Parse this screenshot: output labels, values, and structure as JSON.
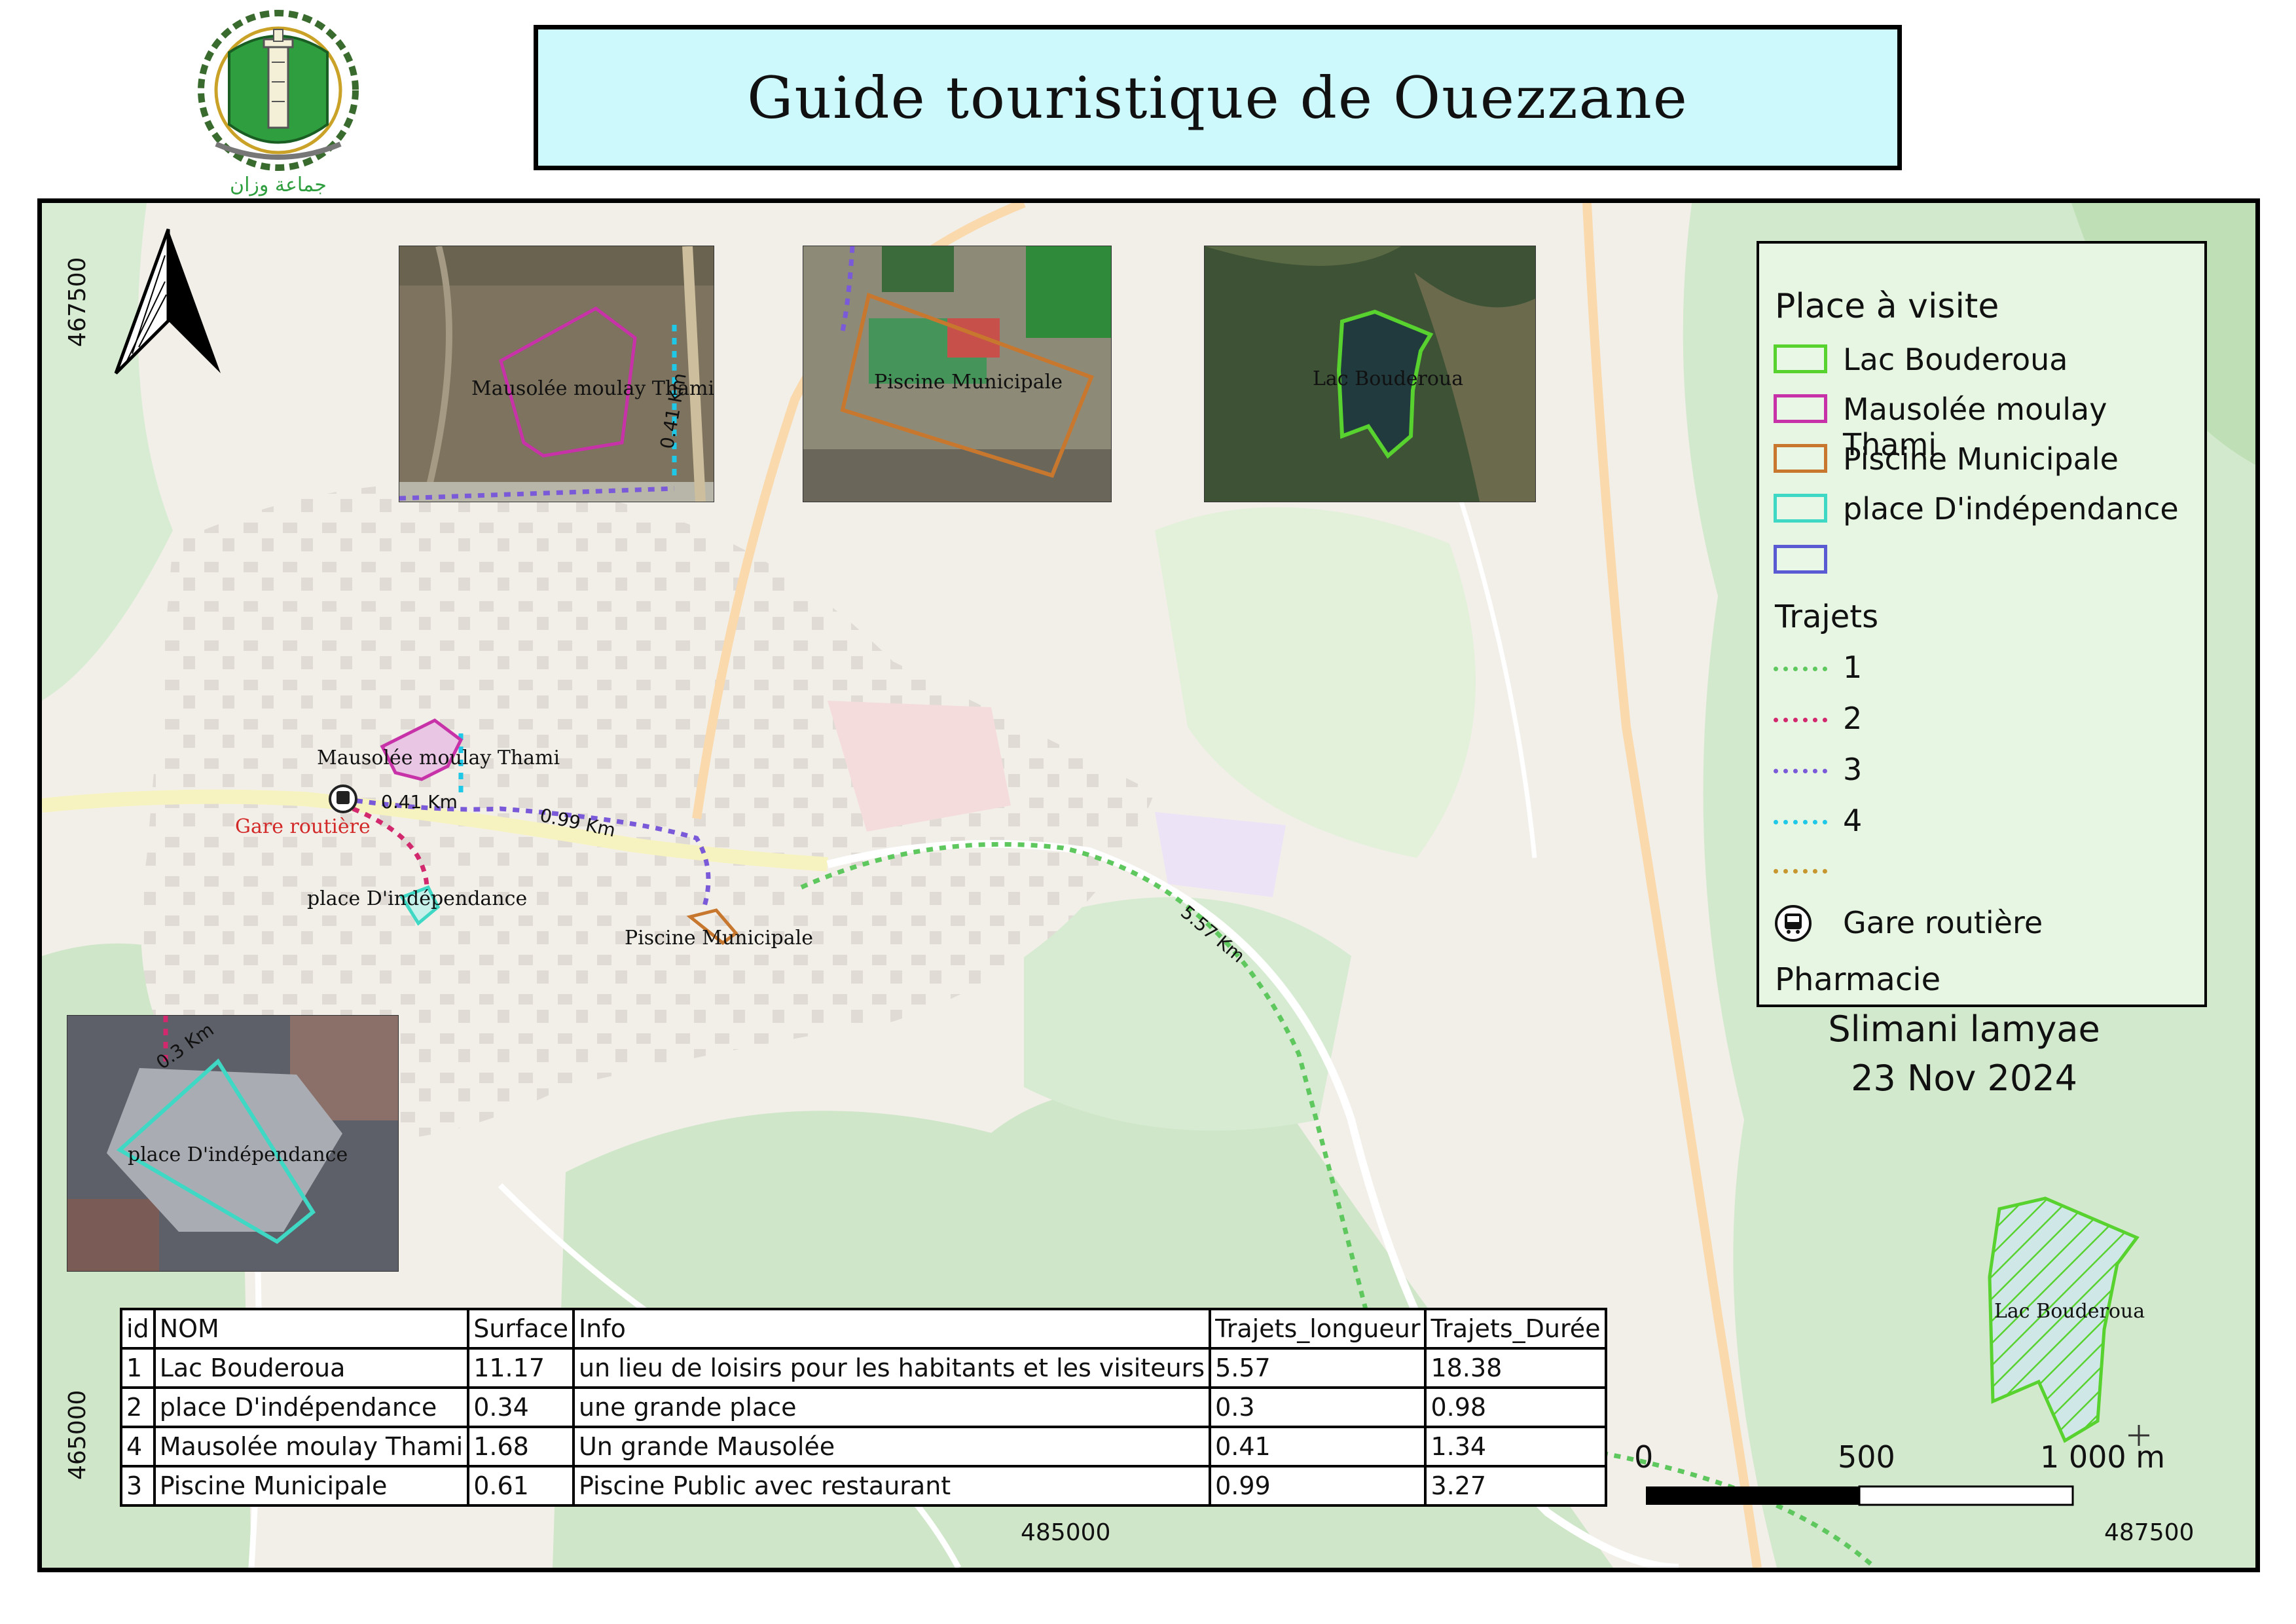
{
  "title": "Guide touristique de Ouezzane",
  "logo": {
    "caption": "جماعة وزان",
    "colors": {
      "green": "#2e9e3e",
      "gold": "#c9a227"
    }
  },
  "north_arrow": {
    "icon": "north-arrow-icon"
  },
  "legend": {
    "places_heading": "Place à visite",
    "places": [
      {
        "label": "Lac Bouderoua",
        "color": "#58d22e"
      },
      {
        "label": "Mausolée moulay Thami",
        "color": "#c832a8"
      },
      {
        "label": "Piscine Municipale",
        "color": "#c8782e"
      },
      {
        "label": "place D'indépendance",
        "color": "#3ed8c4"
      },
      {
        "label": "",
        "color": "#5a5ad2"
      }
    ],
    "trajets_heading": "Trajets",
    "trajets": [
      {
        "label": "1",
        "color": "#5ec85e"
      },
      {
        "label": "2",
        "color": "#d2286e"
      },
      {
        "label": "3",
        "color": "#7a5ad8"
      },
      {
        "label": "4",
        "color": "#1ec8e6"
      },
      {
        "label": "",
        "color": "#c8962e"
      }
    ],
    "bus_label": "Gare routière",
    "pharmacie_label": "Pharmacie"
  },
  "author": "Slimani lamyae",
  "date": "23 Nov 2024",
  "map_labels": {
    "mausolee": "Mausolée moulay Thami",
    "gare": "Gare routière",
    "place": "place D'indépendance",
    "piscine": "Piscine Municipale",
    "lac": "Lac Bouderoua",
    "dist_041": "0.41 Km",
    "dist_099": "0.99 Km",
    "dist_557": "5.57 Km",
    "dist_03": "0.3 Km"
  },
  "insets": {
    "mausolee_label": "Mausolée moulay Thami",
    "mausolee_dist": "0.41 Km",
    "piscine_label": "Piscine Municipale",
    "lac_label": "Lac Bouderoua",
    "place_label": "place D'indépendance",
    "place_dist": "0.3 Km"
  },
  "coordinates": {
    "y_top": "467500",
    "y_bottom": "465000",
    "x_mid": "485000",
    "x_right": "487500"
  },
  "scale_bar": {
    "labels": [
      "0",
      "500",
      "1 000 m"
    ]
  },
  "table": {
    "headers": [
      "id",
      "NOM",
      "Surface",
      "Info",
      "Trajets_longueur",
      "Trajets_Durée"
    ],
    "rows": [
      [
        "1",
        "Lac Bouderoua",
        "11.17",
        "un lieu de loisirs pour les habitants et les visiteurs",
        "5.57",
        "18.38"
      ],
      [
        "2",
        "place D'indépendance",
        "0.34",
        "une grande place",
        "0.3",
        "0.98"
      ],
      [
        "4",
        "Mausolée moulay Thami",
        "1.68",
        "Un grande Mausolée",
        "0.41",
        "1.34"
      ],
      [
        "3",
        "Piscine Municipale",
        "0.61",
        "Piscine Public avec restaurant",
        "0.99",
        "3.27"
      ]
    ]
  }
}
